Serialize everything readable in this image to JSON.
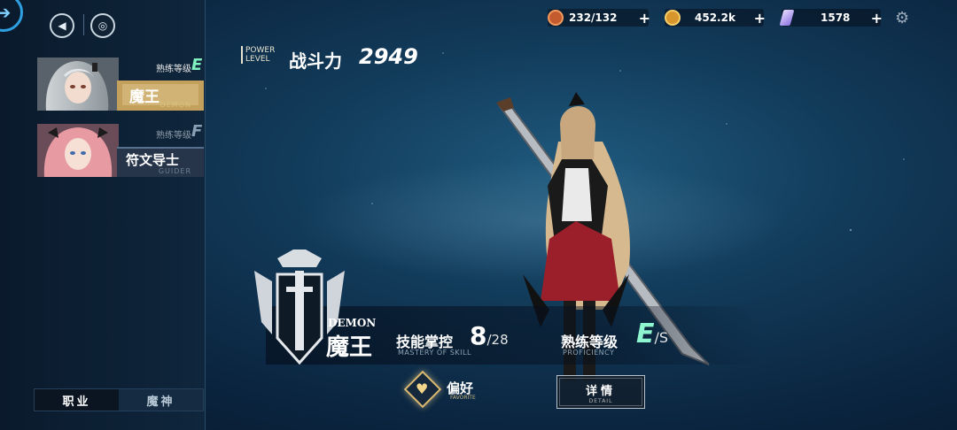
{
  "resources": [
    {
      "name": "stamina",
      "value": "232/132",
      "icon": "stamina-icon",
      "color": "#d46a3a"
    },
    {
      "name": "gold",
      "value": "452.2k",
      "icon": "coin-icon",
      "color": "#e0a23a"
    },
    {
      "name": "crystal",
      "value": "1578",
      "icon": "crystal-icon",
      "color": "#b9a5ff"
    }
  ],
  "power": {
    "label_en_1": "POWER",
    "label_en_2": "LEVEL",
    "label": "战斗力",
    "value": "2949"
  },
  "sidebar": {
    "cards": [
      {
        "rank_label": "熟练等级",
        "rank": "E",
        "name": "魔王",
        "en": "DEMON",
        "selected": true
      },
      {
        "rank_label": "熟练等级",
        "rank": "F",
        "name": "符文导士",
        "en": "GUIDER",
        "selected": false
      }
    ],
    "tabs": [
      "职业",
      "魔神"
    ]
  },
  "job": {
    "en": "DEMON",
    "cn": "魔王"
  },
  "mastery": {
    "label": "技能掌控",
    "en": "MASTERY OF SKILL",
    "current": "8",
    "max": "/28"
  },
  "proficiency": {
    "label": "熟练等级",
    "en": "PROFICIENCY",
    "grade": "E",
    "max": "/S"
  },
  "buttons": {
    "favorite": {
      "cn": "偏好",
      "en": "FAVORITE"
    },
    "detail": {
      "cn": "详情",
      "en": "DETAIL"
    }
  },
  "colors": {
    "accent": "#2e9fe0",
    "grade": "#8ff7cf",
    "gold": "#d9b871"
  }
}
